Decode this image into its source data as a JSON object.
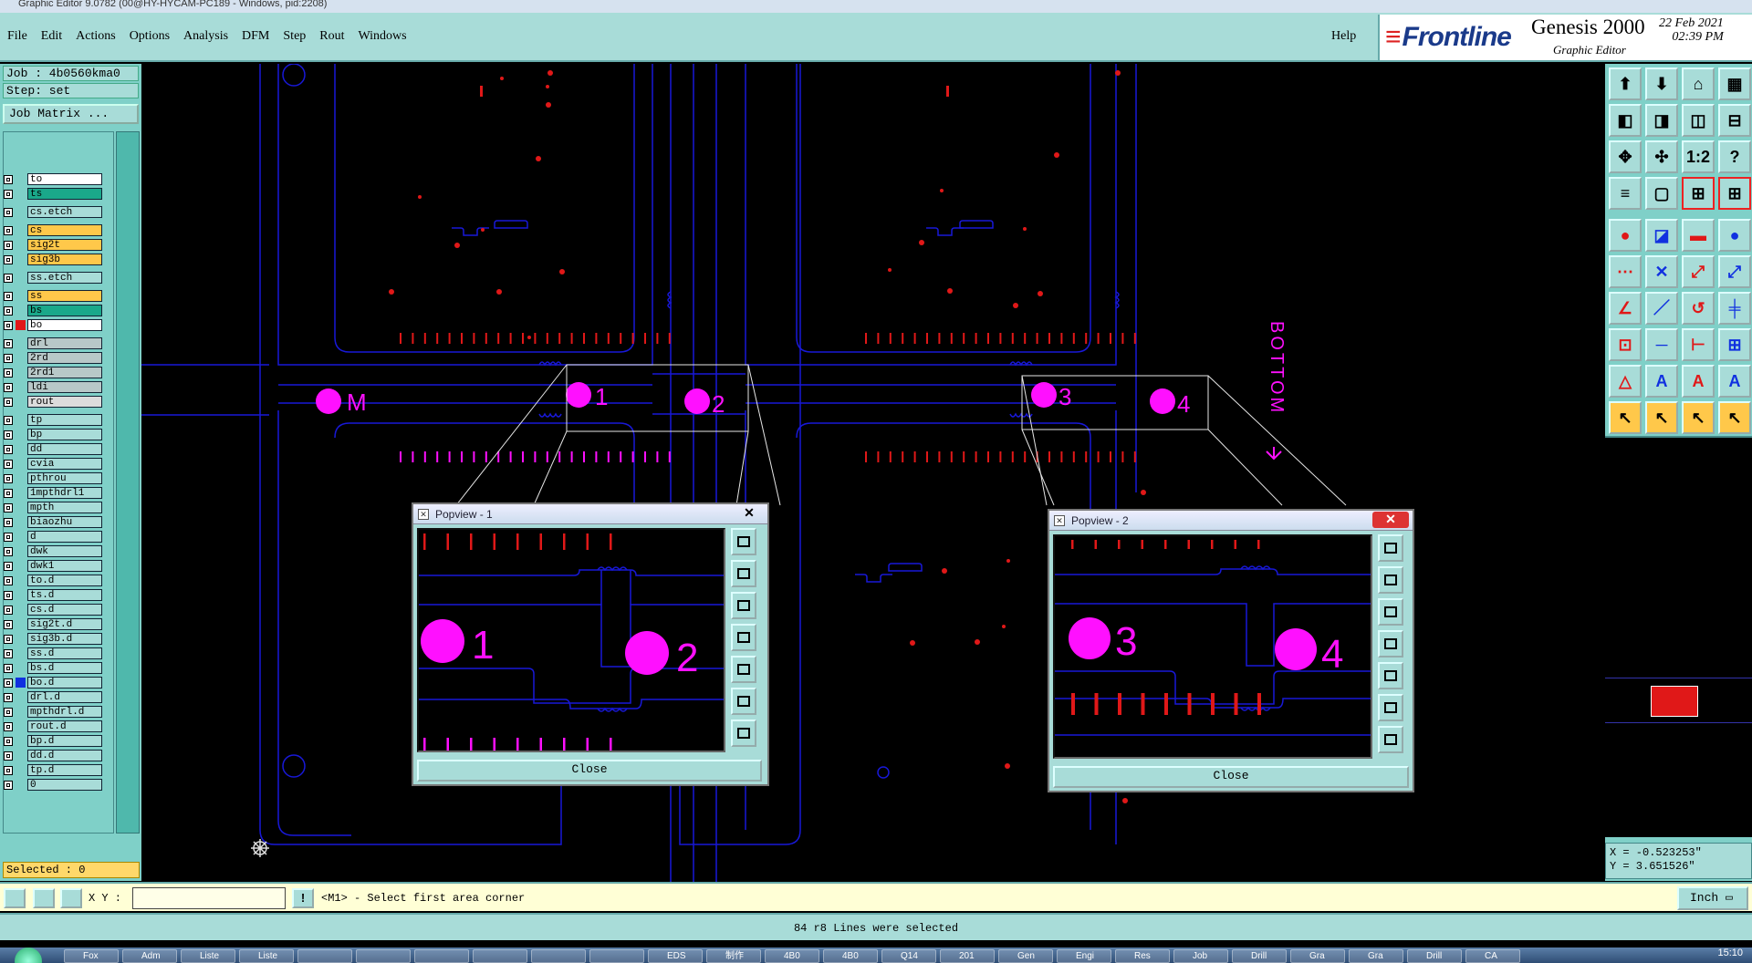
{
  "os_title": "Graphic Editor 9.0782 (00@HY-HYCAM-PC189 - Windows, pid:2208)",
  "menu": {
    "items": [
      {
        "label": "File"
      },
      {
        "label": "Edit"
      },
      {
        "label": "Actions"
      },
      {
        "label": "Options"
      },
      {
        "label": "Analysis"
      },
      {
        "label": "DFM"
      },
      {
        "label": "Step"
      },
      {
        "label": "Rout"
      },
      {
        "label": "Windows"
      }
    ],
    "help": "Help"
  },
  "brand": {
    "logo": "Frontline",
    "product": "Genesis 2000",
    "subtitle": "Graphic Editor",
    "date": "22 Feb 2021",
    "time": "02:39 PM",
    "logo_color": "#1a3a8a"
  },
  "job": {
    "job_label": "Job : 4b0560kma0",
    "step_label": "Step: set",
    "matrix_button": "Job Matrix ..."
  },
  "layers": [
    {
      "name": "to",
      "bg": "#ffffff",
      "color": "",
      "flag": ""
    },
    {
      "name": "ts",
      "bg": "#1aa88a",
      "color": "",
      "flag": ""
    },
    {
      "name": "cs.etch",
      "bg": "#a8dcd8",
      "color": "",
      "flag": ""
    },
    {
      "name": "cs",
      "bg": "#ffc84a",
      "color": "",
      "flag": ""
    },
    {
      "name": "sig2t",
      "bg": "#ffc84a",
      "color": "",
      "flag": ""
    },
    {
      "name": "sig3b",
      "bg": "#ffc84a",
      "color": "",
      "flag": ""
    },
    {
      "name": "ss.etch",
      "bg": "#a8dcd8",
      "color": "",
      "flag": ""
    },
    {
      "name": "ss",
      "bg": "#ffc84a",
      "color": "",
      "flag": ""
    },
    {
      "name": "bs",
      "bg": "#1aa88a",
      "color": "",
      "flag": ""
    },
    {
      "name": "bo",
      "bg": "#ffffff",
      "color": "#e01818",
      "flag": "■"
    },
    {
      "name": "drl",
      "bg": "#b8c8c8",
      "color": "",
      "flag": ""
    },
    {
      "name": "2rd",
      "bg": "#b8c8c8",
      "color": "",
      "flag": ""
    },
    {
      "name": "2rd1",
      "bg": "#b8c8c8",
      "color": "",
      "flag": ""
    },
    {
      "name": "ldi",
      "bg": "#b8c8c8",
      "color": "",
      "flag": ""
    },
    {
      "name": "rout",
      "bg": "#dcdcdc",
      "color": "",
      "flag": ""
    },
    {
      "name": "tp",
      "bg": "#a8dcd8",
      "color": "",
      "flag": ""
    },
    {
      "name": "bp",
      "bg": "#a8dcd8",
      "color": "",
      "flag": ""
    },
    {
      "name": "dd",
      "bg": "#a8dcd8",
      "color": "",
      "flag": ""
    },
    {
      "name": "cvia",
      "bg": "#a8dcd8",
      "color": "",
      "flag": ""
    },
    {
      "name": "pthrou",
      "bg": "#a8dcd8",
      "color": "",
      "flag": ""
    },
    {
      "name": "1mpthdrl1",
      "bg": "#a8dcd8",
      "color": "",
      "flag": ""
    },
    {
      "name": "mpth",
      "bg": "#a8dcd8",
      "color": "",
      "flag": ""
    },
    {
      "name": "biaozhu",
      "bg": "#a8dcd8",
      "color": "",
      "flag": ""
    },
    {
      "name": "d",
      "bg": "#a8dcd8",
      "color": "",
      "flag": ""
    },
    {
      "name": "dwk",
      "bg": "#a8dcd8",
      "color": "",
      "flag": ""
    },
    {
      "name": "dwk1",
      "bg": "#a8dcd8",
      "color": "",
      "flag": ""
    },
    {
      "name": "to.d",
      "bg": "#a8dcd8",
      "color": "",
      "flag": "✎"
    },
    {
      "name": "ts.d",
      "bg": "#a8dcd8",
      "color": "",
      "flag": ""
    },
    {
      "name": "cs.d",
      "bg": "#a8dcd8",
      "color": "",
      "flag": ""
    },
    {
      "name": "sig2t.d",
      "bg": "#a8dcd8",
      "color": "",
      "flag": ""
    },
    {
      "name": "sig3b.d",
      "bg": "#a8dcd8",
      "color": "",
      "flag": ""
    },
    {
      "name": "ss.d",
      "bg": "#a8dcd8",
      "color": "",
      "flag": ""
    },
    {
      "name": "bs.d",
      "bg": "#a8dcd8",
      "color": "",
      "flag": ""
    },
    {
      "name": "bo.d",
      "bg": "#a8dcd8",
      "color": "#1030e0",
      "flag": "✎"
    },
    {
      "name": "drl.d",
      "bg": "#a8dcd8",
      "color": "",
      "flag": ""
    },
    {
      "name": "mpthdrl.d",
      "bg": "#a8dcd8",
      "color": "",
      "flag": ""
    },
    {
      "name": "rout.d",
      "bg": "#a8dcd8",
      "color": "",
      "flag": ""
    },
    {
      "name": "bp.d",
      "bg": "#a8dcd8",
      "color": "",
      "flag": ""
    },
    {
      "name": "dd.d",
      "bg": "#a8dcd8",
      "color": "",
      "flag": ""
    },
    {
      "name": "tp.d",
      "bg": "#a8dcd8",
      "color": "",
      "flag": ""
    },
    {
      "name": "0",
      "bg": "#a8dcd8",
      "color": "",
      "flag": ""
    }
  ],
  "selected": "Selected : 0",
  "canvas": {
    "labels": {
      "m": "M",
      "one": "1",
      "two": "2",
      "three": "3",
      "four": "4",
      "bottom": "BOTTOM"
    },
    "magenta": "#ff10ff",
    "trace_color": "#1818d8",
    "pad_color": "#e01818"
  },
  "popview1": {
    "title": "Popview - 1",
    "close": "Close",
    "n1": "1",
    "n2": "2"
  },
  "popview2": {
    "title": "Popview - 2",
    "close": "Close",
    "n1": "3",
    "n2": "4"
  },
  "coords": {
    "x": "X = -0.523253\"",
    "y": "Y = 3.651526\""
  },
  "command": {
    "xy_label": "X Y :",
    "xy_value": "",
    "prompt": "<M1> - Select first area corner",
    "units": "Inch"
  },
  "status": "84 r8 Lines were selected",
  "taskbar": {
    "items": [
      "Fox",
      "Adm",
      "Liste",
      "Liste",
      "",
      "",
      "",
      "",
      "",
      "",
      "EDS",
      "制作",
      "4B0",
      "4B0",
      "Q14",
      "201",
      "Gen",
      "Engi",
      "Res",
      "Job",
      "Drill",
      "Gra",
      "Gra",
      "Drill",
      "CA"
    ],
    "clock": "15:10"
  }
}
